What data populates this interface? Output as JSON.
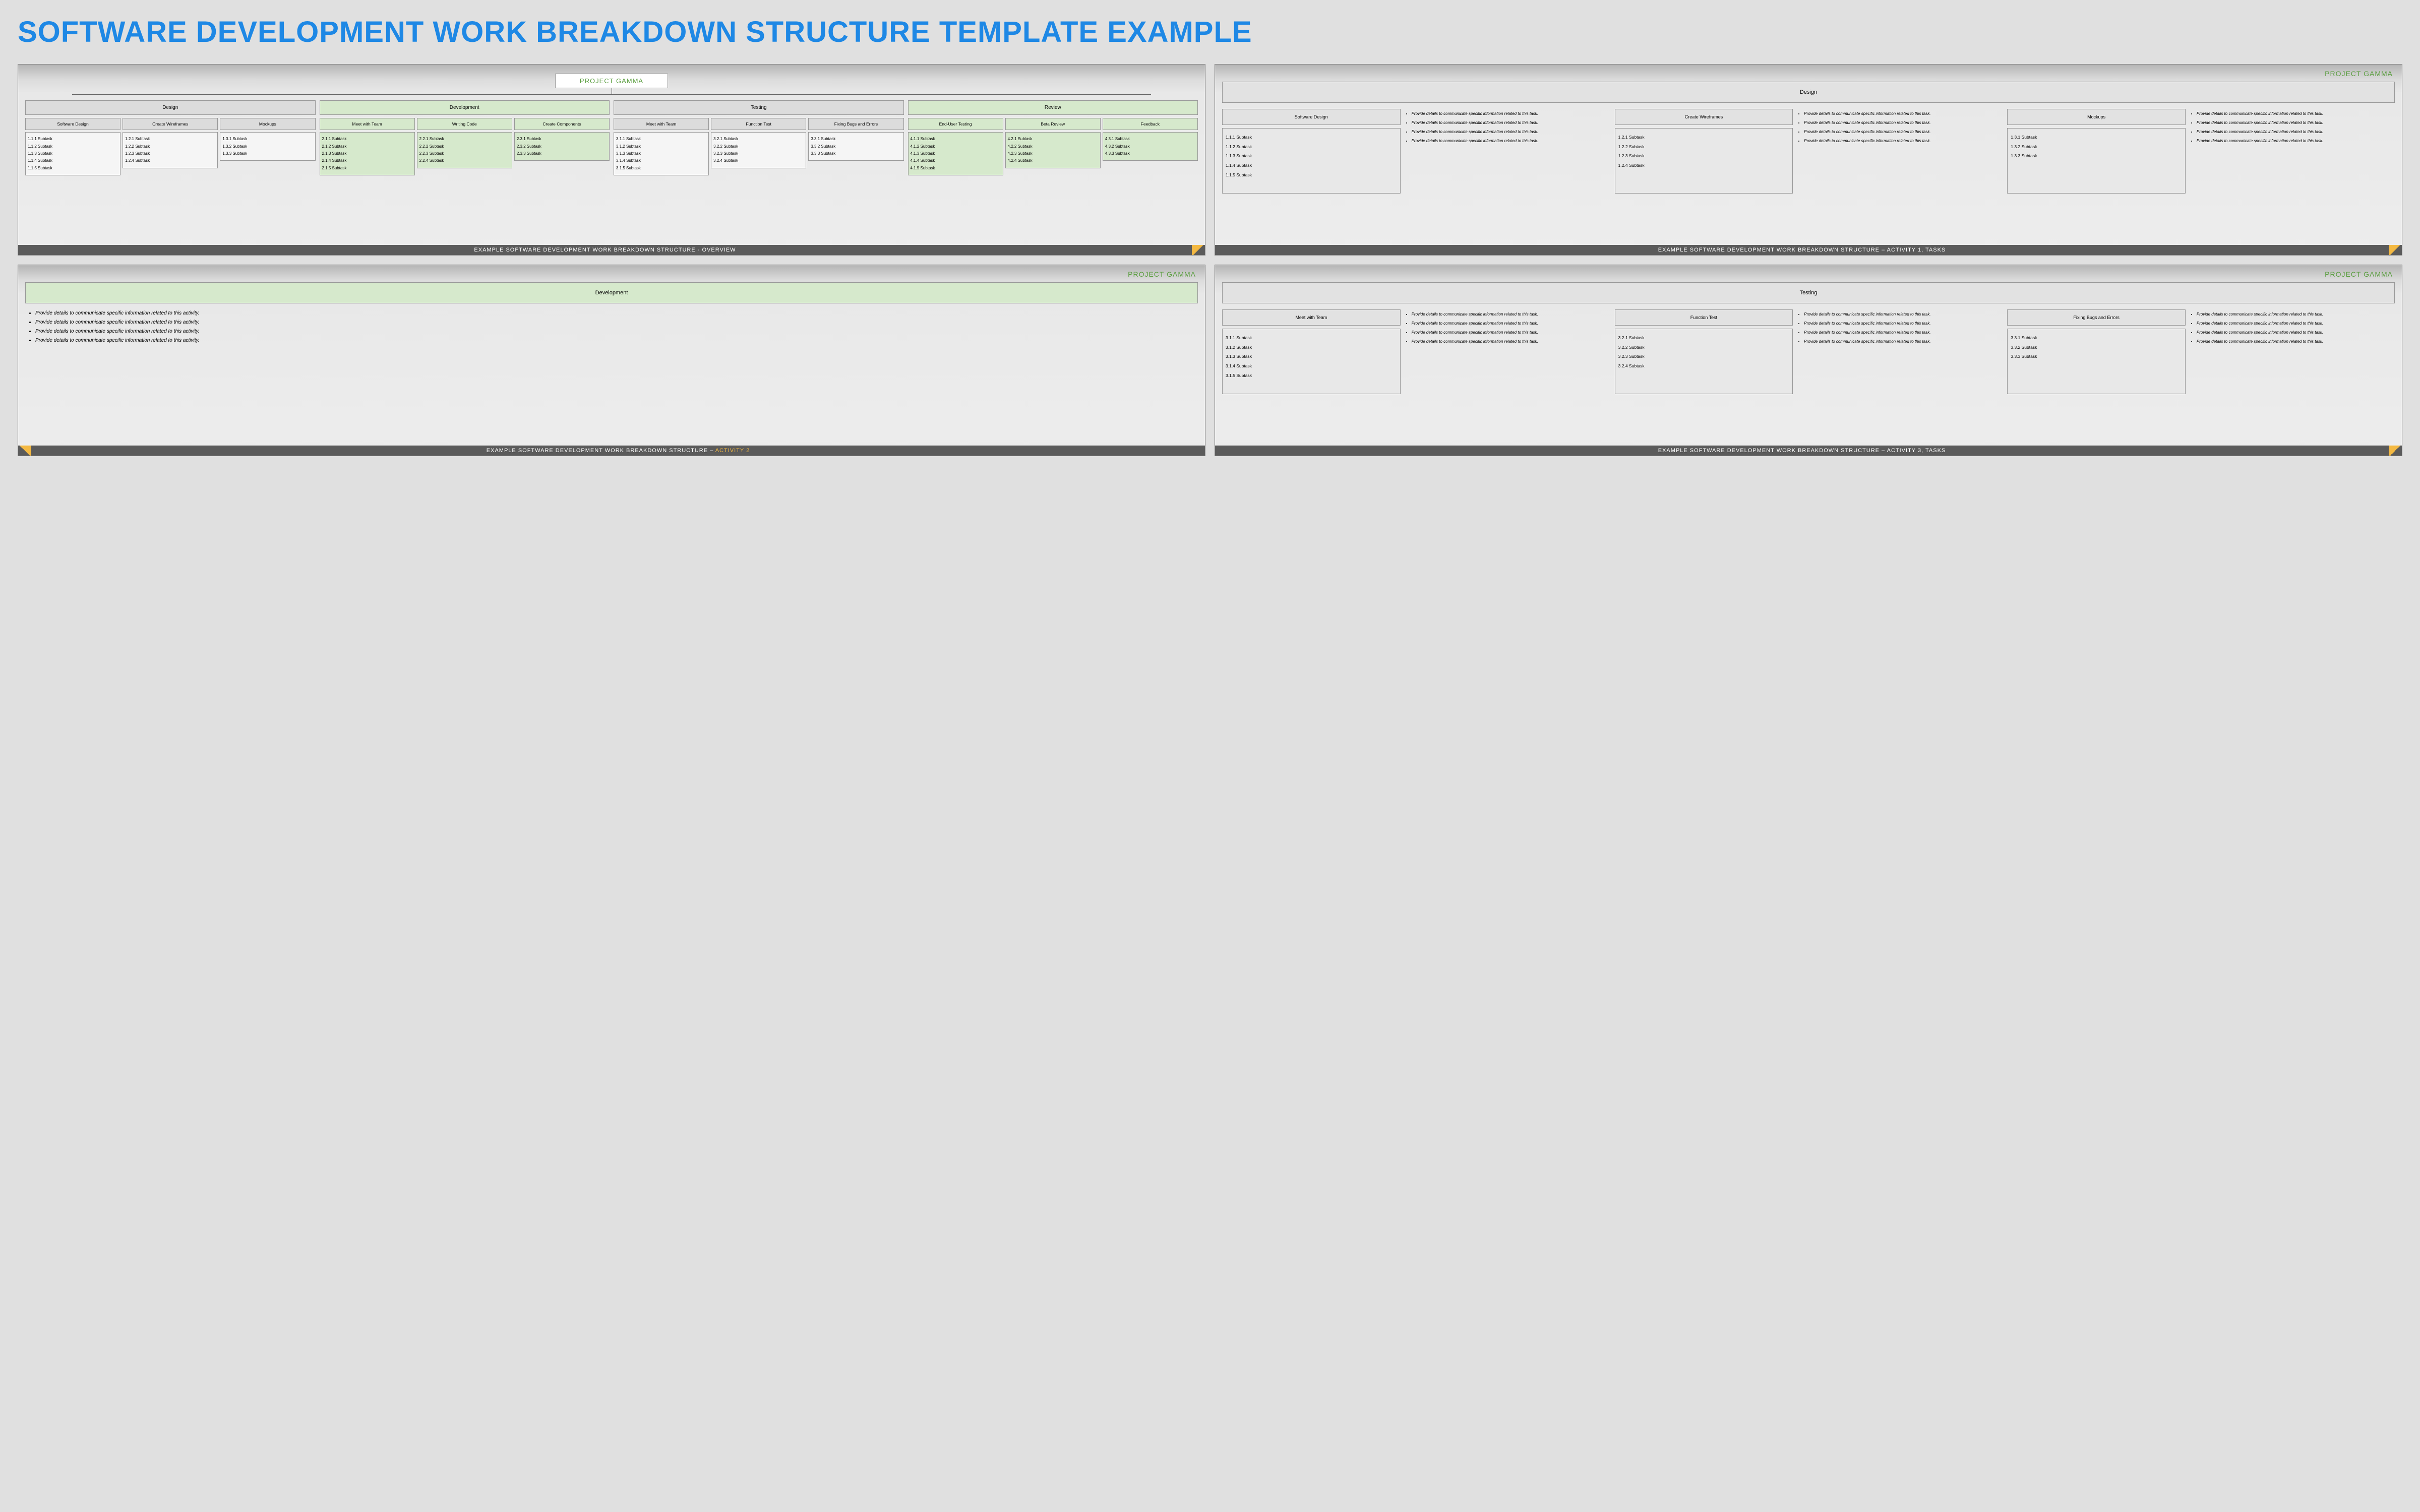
{
  "page_title": "SOFTWARE DEVELOPMENT WORK BREAKDOWN STRUCTURE TEMPLATE EXAMPLE",
  "project_name": "PROJECT GAMMA",
  "footer_base": "EXAMPLE SOFTWARE DEVELOPMENT WORK BREAKDOWN STRUCTURE",
  "task_detail_bullet": "Provide details to communicate specific information related to this task.",
  "activity_detail_bullet": "Provide details to communicate specific information related to this activity.",
  "slide1": {
    "footer_suffix": " - OVERVIEW",
    "root": "PROJECT GAMMA",
    "activities": [
      {
        "name": "Design",
        "color": "gray",
        "tasks": [
          {
            "name": "Software Design",
            "subs": [
              "1.1.1 Subtask",
              "1.1.2 Subtask",
              "1.1.3 Subtask",
              "1.1.4 Subtask",
              "1.1.5 Subtask"
            ]
          },
          {
            "name": "Create Wireframes",
            "subs": [
              "1.2.1 Subtask",
              "1.2.2 Subtask",
              "1.2.3 Subtask",
              "1.2.4 Subtask"
            ]
          },
          {
            "name": "Mockups",
            "subs": [
              "1.3.1 Subtask",
              "1.3.2 Subtask",
              "1.3.3 Subtask"
            ]
          }
        ]
      },
      {
        "name": "Development",
        "color": "green",
        "tasks": [
          {
            "name": "Meet with Team",
            "subs": [
              "2.1.1 Subtask",
              "2.1.2 Subtask",
              "2.1.3 Subtask",
              "2.1.4 Subtask",
              "2.1.5 Subtask"
            ]
          },
          {
            "name": "Writing Code",
            "subs": [
              "2.2.1 Subtask",
              "2.2.2 Subtask",
              "2.2.3 Subtask",
              "2.2.4 Subtask"
            ]
          },
          {
            "name": "Create Components",
            "subs": [
              "2.3.1 Subtask",
              "2.3.2 Subtask",
              "2.3.3 Subtask"
            ]
          }
        ]
      },
      {
        "name": "Testing",
        "color": "gray",
        "tasks": [
          {
            "name": "Meet with Team",
            "subs": [
              "3.1.1 Subtask",
              "3.1.2 Subtask",
              "3.1.3 Subtask",
              "3.1.4 Subtask",
              "3.1.5 Subtask"
            ]
          },
          {
            "name": "Function Test",
            "subs": [
              "3.2.1 Subtask",
              "3.2.2 Subtask",
              "3.2.3 Subtask",
              "3.2.4 Subtask"
            ]
          },
          {
            "name": "Fixing Bugs and Errors",
            "subs": [
              "3.3.1 Subtask",
              "3.3.2 Subtask",
              "3.3.3 Subtask"
            ]
          }
        ]
      },
      {
        "name": "Review",
        "color": "green",
        "tasks": [
          {
            "name": "End-User Testing",
            "subs": [
              "4.1.1 Subtask",
              "4.1.2 Subtask",
              "4.1.3 Subtask",
              "4.1.4 Subtask",
              "4.1.5 Subtask"
            ]
          },
          {
            "name": "Beta Review",
            "subs": [
              "4.2.1 Subtask",
              "4.2.2 Subtask",
              "4.2.3 Subtask",
              "4.2.4 Subtask"
            ]
          },
          {
            "name": "Feedback",
            "subs": [
              "4.3.1 Subtask",
              "4.3.2 Subtask",
              "4.3.3 Subtask"
            ]
          }
        ]
      }
    ]
  },
  "slide2": {
    "footer_suffix": " – ACTIVITY 1, TASKS",
    "activity_name": "Design",
    "tasks": [
      {
        "name": "Software Design",
        "subs": [
          "1.1.1 Subtask",
          "1.1.2 Subtask",
          "1.1.3 Subtask",
          "1.1.4 Subtask",
          "1.1.5 Subtask"
        ]
      },
      {
        "name": "Create Wireframes",
        "subs": [
          "1.2.1 Subtask",
          "1.2.2 Subtask",
          "1.2.3 Subtask",
          "1.2.4 Subtask"
        ]
      },
      {
        "name": "Mockups",
        "subs": [
          "1.3.1 Subtask",
          "1.3.2 Subtask",
          "1.3.3 Subtask"
        ]
      }
    ]
  },
  "slide3": {
    "footer_suffix_pre": " – ",
    "footer_suffix_accent": "ACTIVITY 2",
    "activity_name": "Development",
    "detail_count": 4
  },
  "slide4": {
    "footer_suffix": " – ACTIVITY 3, TASKS",
    "activity_name": "Testing",
    "tasks": [
      {
        "name": "Meet with Team",
        "subs": [
          "3.1.1 Subtask",
          "3.1.2 Subtask",
          "3.1.3 Subtask",
          "3.1.4 Subtask",
          "3.1.5 Subtask"
        ]
      },
      {
        "name": "Function Test",
        "subs": [
          "3.2.1 Subtask",
          "3.2.2 Subtask",
          "3.2.3 Subtask",
          "3.2.4 Subtask"
        ]
      },
      {
        "name": "Fixing Bugs and Errors",
        "subs": [
          "3.3.1 Subtask",
          "3.3.2 Subtask",
          "3.3.3 Subtask"
        ]
      }
    ]
  }
}
